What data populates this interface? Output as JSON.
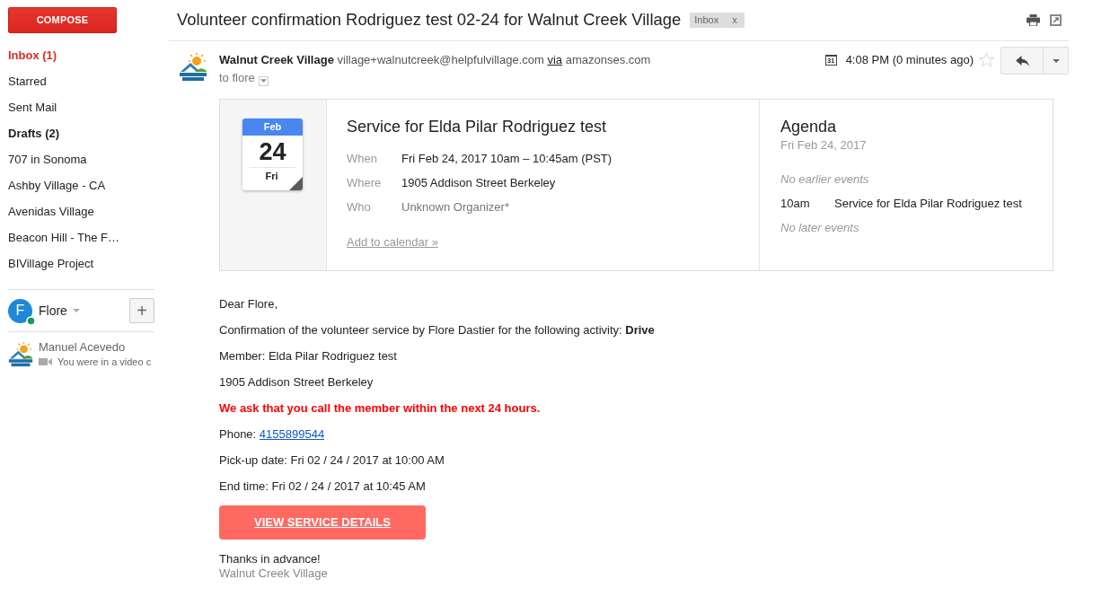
{
  "sidebar": {
    "compose_button": "COMPOSE",
    "folders": [
      {
        "label": "Inbox (1)",
        "selected": true,
        "unread": true
      },
      {
        "label": "Starred",
        "selected": false,
        "unread": false
      },
      {
        "label": "Sent Mail",
        "selected": false,
        "unread": false
      },
      {
        "label": "Drafts (2)",
        "selected": false,
        "unread": true
      },
      {
        "label": "707 in Sonoma",
        "selected": false,
        "unread": false
      },
      {
        "label": "Ashby Village - CA",
        "selected": false,
        "unread": false
      },
      {
        "label": "Avenidas Village",
        "selected": false,
        "unread": false
      },
      {
        "label": "Beacon Hill - The F…",
        "selected": false,
        "unread": false
      },
      {
        "label": "BIVillage Project",
        "selected": false,
        "unread": false
      }
    ],
    "chat": {
      "user": {
        "initial": "F",
        "name": "Flore",
        "online": true
      },
      "add_button": "+",
      "contacts": [
        {
          "name": "Manuel Acevedo",
          "status": "You were in a video c"
        }
      ]
    }
  },
  "email": {
    "subject": "Volunteer confirmation Rodriguez test 02-24 for Walnut Creek Village",
    "labels": [
      {
        "text": "Inbox",
        "remove": "x"
      }
    ],
    "sender": {
      "name": "Walnut Creek Village",
      "address": "village+walnutcreek@helpfulvillage.com",
      "via_label": "via",
      "via_domain": "amazonses.com"
    },
    "recipient": "to flore",
    "calendar_badge": "31",
    "time": "4:08 PM (0 minutes ago)",
    "starred": false,
    "invitation": {
      "date_card": {
        "month": "Feb",
        "day": "24",
        "weekday": "Fri"
      },
      "title": "Service for Elda Pilar Rodriguez test",
      "details": [
        {
          "label": "When",
          "value": "Fri Feb 24, 2017 10am – 10:45am (PST)",
          "greyed": false
        },
        {
          "label": "Where",
          "value": "1905 Addison Street Berkeley",
          "greyed": false
        },
        {
          "label": "Who",
          "value": "Unknown Organizer*",
          "greyed": true
        }
      ],
      "add_link": "Add to calendar »",
      "agenda": {
        "title": "Agenda",
        "date": "Fri Feb 24, 2017",
        "items": [
          {
            "kind": "note",
            "text": "No earlier events"
          },
          {
            "kind": "event",
            "time": "10am",
            "title": "Service for Elda Pilar Rodriguez test"
          },
          {
            "kind": "note",
            "text": "No later events"
          }
        ]
      }
    },
    "body": {
      "lines": [
        {
          "kind": "text",
          "text": "Dear Flore,"
        },
        {
          "kind": "text",
          "text": "Confirmation of the volunteer service by Flore Dastier for the following activity: **Drive**"
        },
        {
          "kind": "text",
          "text": "Member: Elda Pilar Rodriguez test"
        },
        {
          "kind": "text",
          "text": "1905 Addison Street Berkeley"
        },
        {
          "kind": "alert",
          "text": "We ask that you call the member within the next 24 hours."
        },
        {
          "kind": "phone",
          "label": "Phone:",
          "link": "4155899544"
        },
        {
          "kind": "text",
          "text": "Pick-up date: Fri 02 / 24 / 2017 at 10:00 AM"
        },
        {
          "kind": "text",
          "text": "End time: Fri 02 / 24 / 2017 at 10:45 AM"
        }
      ],
      "button": "VIEW SERVICE DETAILS",
      "closing": "Thanks in advance!",
      "signature": "Walnut Creek Village"
    }
  }
}
